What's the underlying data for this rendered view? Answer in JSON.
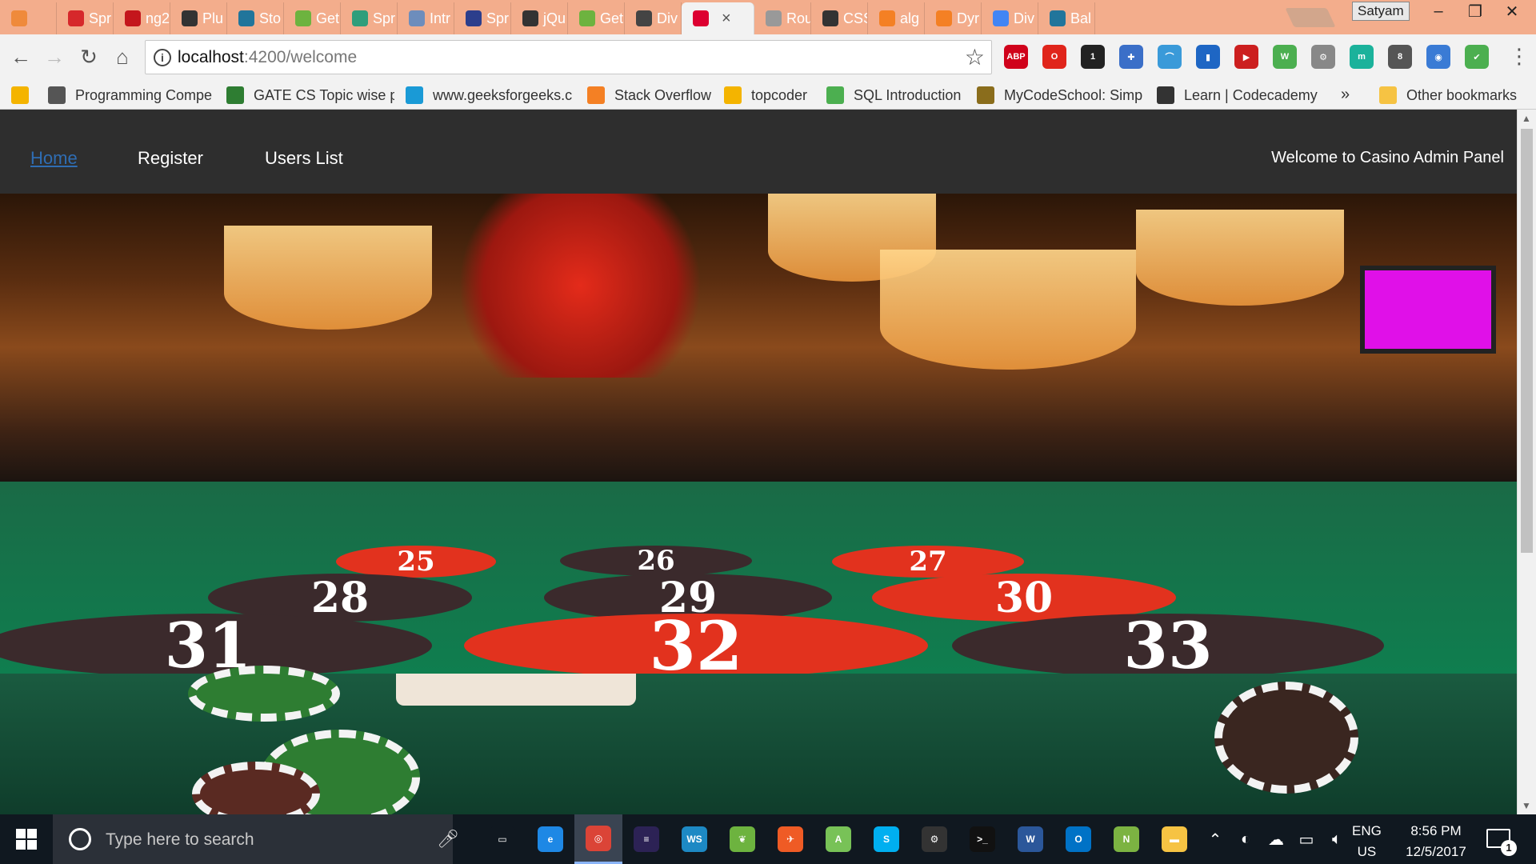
{
  "browser": {
    "tabs": [
      {
        "title": "",
        "color": "#ef8a3b"
      },
      {
        "title": "Spr",
        "color": "#d6282b"
      },
      {
        "title": "ng2",
        "color": "#c4161c"
      },
      {
        "title": "Plu",
        "color": "#333333"
      },
      {
        "title": "Sto",
        "color": "#21759b"
      },
      {
        "title": "Get",
        "color": "#6db33f"
      },
      {
        "title": "Spr",
        "color": "#2f9e7b"
      },
      {
        "title": "Intr",
        "color": "#6d8dbc"
      },
      {
        "title": "Spr",
        "color": "#2c3e8c"
      },
      {
        "title": "jQu",
        "color": "#333333"
      },
      {
        "title": "Get",
        "color": "#6db33f"
      },
      {
        "title": "Div",
        "color": "#444444"
      },
      {
        "title": "",
        "color": "#dd0031",
        "active": true
      },
      {
        "title": "Rou",
        "color": "#999999"
      },
      {
        "title": "CSS",
        "color": "#333333"
      },
      {
        "title": "alg",
        "color": "#f48024"
      },
      {
        "title": "Dyr",
        "color": "#f48024"
      },
      {
        "title": "Div",
        "color": "#4285f4"
      },
      {
        "title": "Bal",
        "color": "#21759b"
      }
    ],
    "profile_name": "Satyam",
    "url_host": "localhost",
    "url_path": ":4200/welcome",
    "extensions": [
      {
        "name": "abp-icon",
        "label": "ABP",
        "color": "#d0021b"
      },
      {
        "name": "opera-icon",
        "label": "O",
        "color": "#e0251b"
      },
      {
        "name": "ghost-icon",
        "label": "1",
        "color": "#222222"
      },
      {
        "name": "puzzle-icon",
        "label": "✚",
        "color": "#3b6fc8"
      },
      {
        "name": "arc-icon",
        "label": "⌒",
        "color": "#3a9ad9"
      },
      {
        "name": "bookmark-ext-icon",
        "label": "▮",
        "color": "#1e66c4"
      },
      {
        "name": "video-icon",
        "label": "▶",
        "color": "#cc1f1f"
      },
      {
        "name": "w-icon",
        "label": "W",
        "color": "#4caf50"
      },
      {
        "name": "gear-ext-icon",
        "label": "⚙",
        "color": "#888888"
      },
      {
        "name": "m-icon",
        "label": "m",
        "color": "#1bb29b"
      },
      {
        "name": "badge-ext-icon",
        "label": "8",
        "color": "#555555"
      },
      {
        "name": "eye-icon",
        "label": "◉",
        "color": "#3a7bd5"
      },
      {
        "name": "green-ext-icon",
        "label": "✔",
        "color": "#4caf50"
      }
    ],
    "bookmarks": [
      {
        "label": "",
        "color": "#f4b400"
      },
      {
        "label": "Programming Compe",
        "color": "#555555"
      },
      {
        "label": "GATE CS Topic wise p",
        "color": "#2e7d32"
      },
      {
        "label": "www.geeksforgeeks.c",
        "color": "#1a9ad6"
      },
      {
        "label": "Stack Overflow",
        "color": "#f48024"
      },
      {
        "label": "topcoder",
        "color": "#f4b400"
      },
      {
        "label": "SQL Introduction",
        "color": "#4caf50"
      },
      {
        "label": "MyCodeSchool: Simp",
        "color": "#8a6d1c"
      },
      {
        "label": "Learn | Codecademy",
        "color": "#333333"
      }
    ],
    "bookmarks_more": "»",
    "other_bookmarks": "Other bookmarks"
  },
  "app": {
    "nav": {
      "home": "Home",
      "register": "Register",
      "users_list": "Users List"
    },
    "brand_text": "Welcome to Casino Admin Panel",
    "hero_numbers": [
      "25",
      "26",
      "27",
      "28",
      "29",
      "30",
      "31",
      "32",
      "33"
    ]
  },
  "taskbar": {
    "search_placeholder": "Type here to search",
    "apps": [
      {
        "name": "task-view-icon",
        "label": "▭",
        "color": "#101820"
      },
      {
        "name": "edge-icon",
        "label": "e",
        "color": "#1e88e5"
      },
      {
        "name": "chrome-icon",
        "label": "◎",
        "color": "#db4437",
        "active": true
      },
      {
        "name": "eclipse-icon",
        "label": "≡",
        "color": "#2c2255"
      },
      {
        "name": "webstorm-icon",
        "label": "WS",
        "color": "#1d89c4"
      },
      {
        "name": "spring-icon",
        "label": "❦",
        "color": "#6db33f"
      },
      {
        "name": "postman-icon",
        "label": "✈",
        "color": "#ef5b25"
      },
      {
        "name": "android-icon",
        "label": "A",
        "color": "#78c257"
      },
      {
        "name": "skype-icon",
        "label": "S",
        "color": "#00aff0"
      },
      {
        "name": "settings-app-icon",
        "label": "⚙",
        "color": "#333333"
      },
      {
        "name": "terminal-icon",
        "label": ">_",
        "color": "#111111"
      },
      {
        "name": "word-icon",
        "label": "W",
        "color": "#2b579a"
      },
      {
        "name": "outlook-icon",
        "label": "O",
        "color": "#0072c6"
      },
      {
        "name": "notepadpp-icon",
        "label": "N",
        "color": "#7cb342"
      },
      {
        "name": "explorer-icon",
        "label": "▬",
        "color": "#f6c343"
      }
    ],
    "lang_line1": "ENG",
    "lang_line2": "US",
    "time": "8:56 PM",
    "date": "12/5/2017",
    "notifications": "1"
  },
  "colors": {
    "navbar_bg": "#2e2e2e",
    "home_link": "#2f6db3",
    "tab_strip": "#f3ad8c"
  }
}
